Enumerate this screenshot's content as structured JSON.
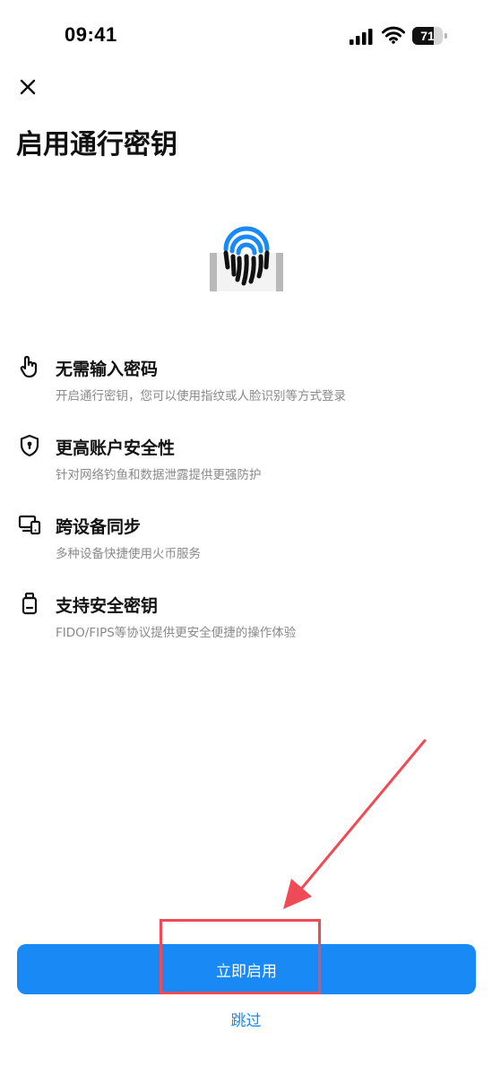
{
  "status_bar": {
    "time": "09:41",
    "battery_level": "71",
    "battery_fraction": 0.71
  },
  "header": {
    "close_icon": "close-icon",
    "title": "启用通行密钥"
  },
  "hero": {
    "icon": "fingerprint-icon",
    "accent_color": "#1889f5"
  },
  "features": [
    {
      "icon": "touch-hand-icon",
      "title": "无需输入密码",
      "description": "开启通行密钥，您可以使用指纹或人脸识别等方式登录"
    },
    {
      "icon": "shield-lock-icon",
      "title": "更高账户安全性",
      "description": "针对网络钓鱼和数据泄露提供更强防护"
    },
    {
      "icon": "devices-sync-icon",
      "title": "跨设备同步",
      "description": "多种设备快捷使用火币服务"
    },
    {
      "icon": "security-key-icon",
      "title": "支持安全密钥",
      "description": "FIDO/FIPS等协议提供更安全便捷的操作体验"
    }
  ],
  "actions": {
    "primary_label": "立即启用",
    "skip_label": "跳过"
  },
  "colors": {
    "primary": "#1889f5",
    "annotation": "#ef4b57",
    "secondary_text": "#8a8a8a"
  }
}
